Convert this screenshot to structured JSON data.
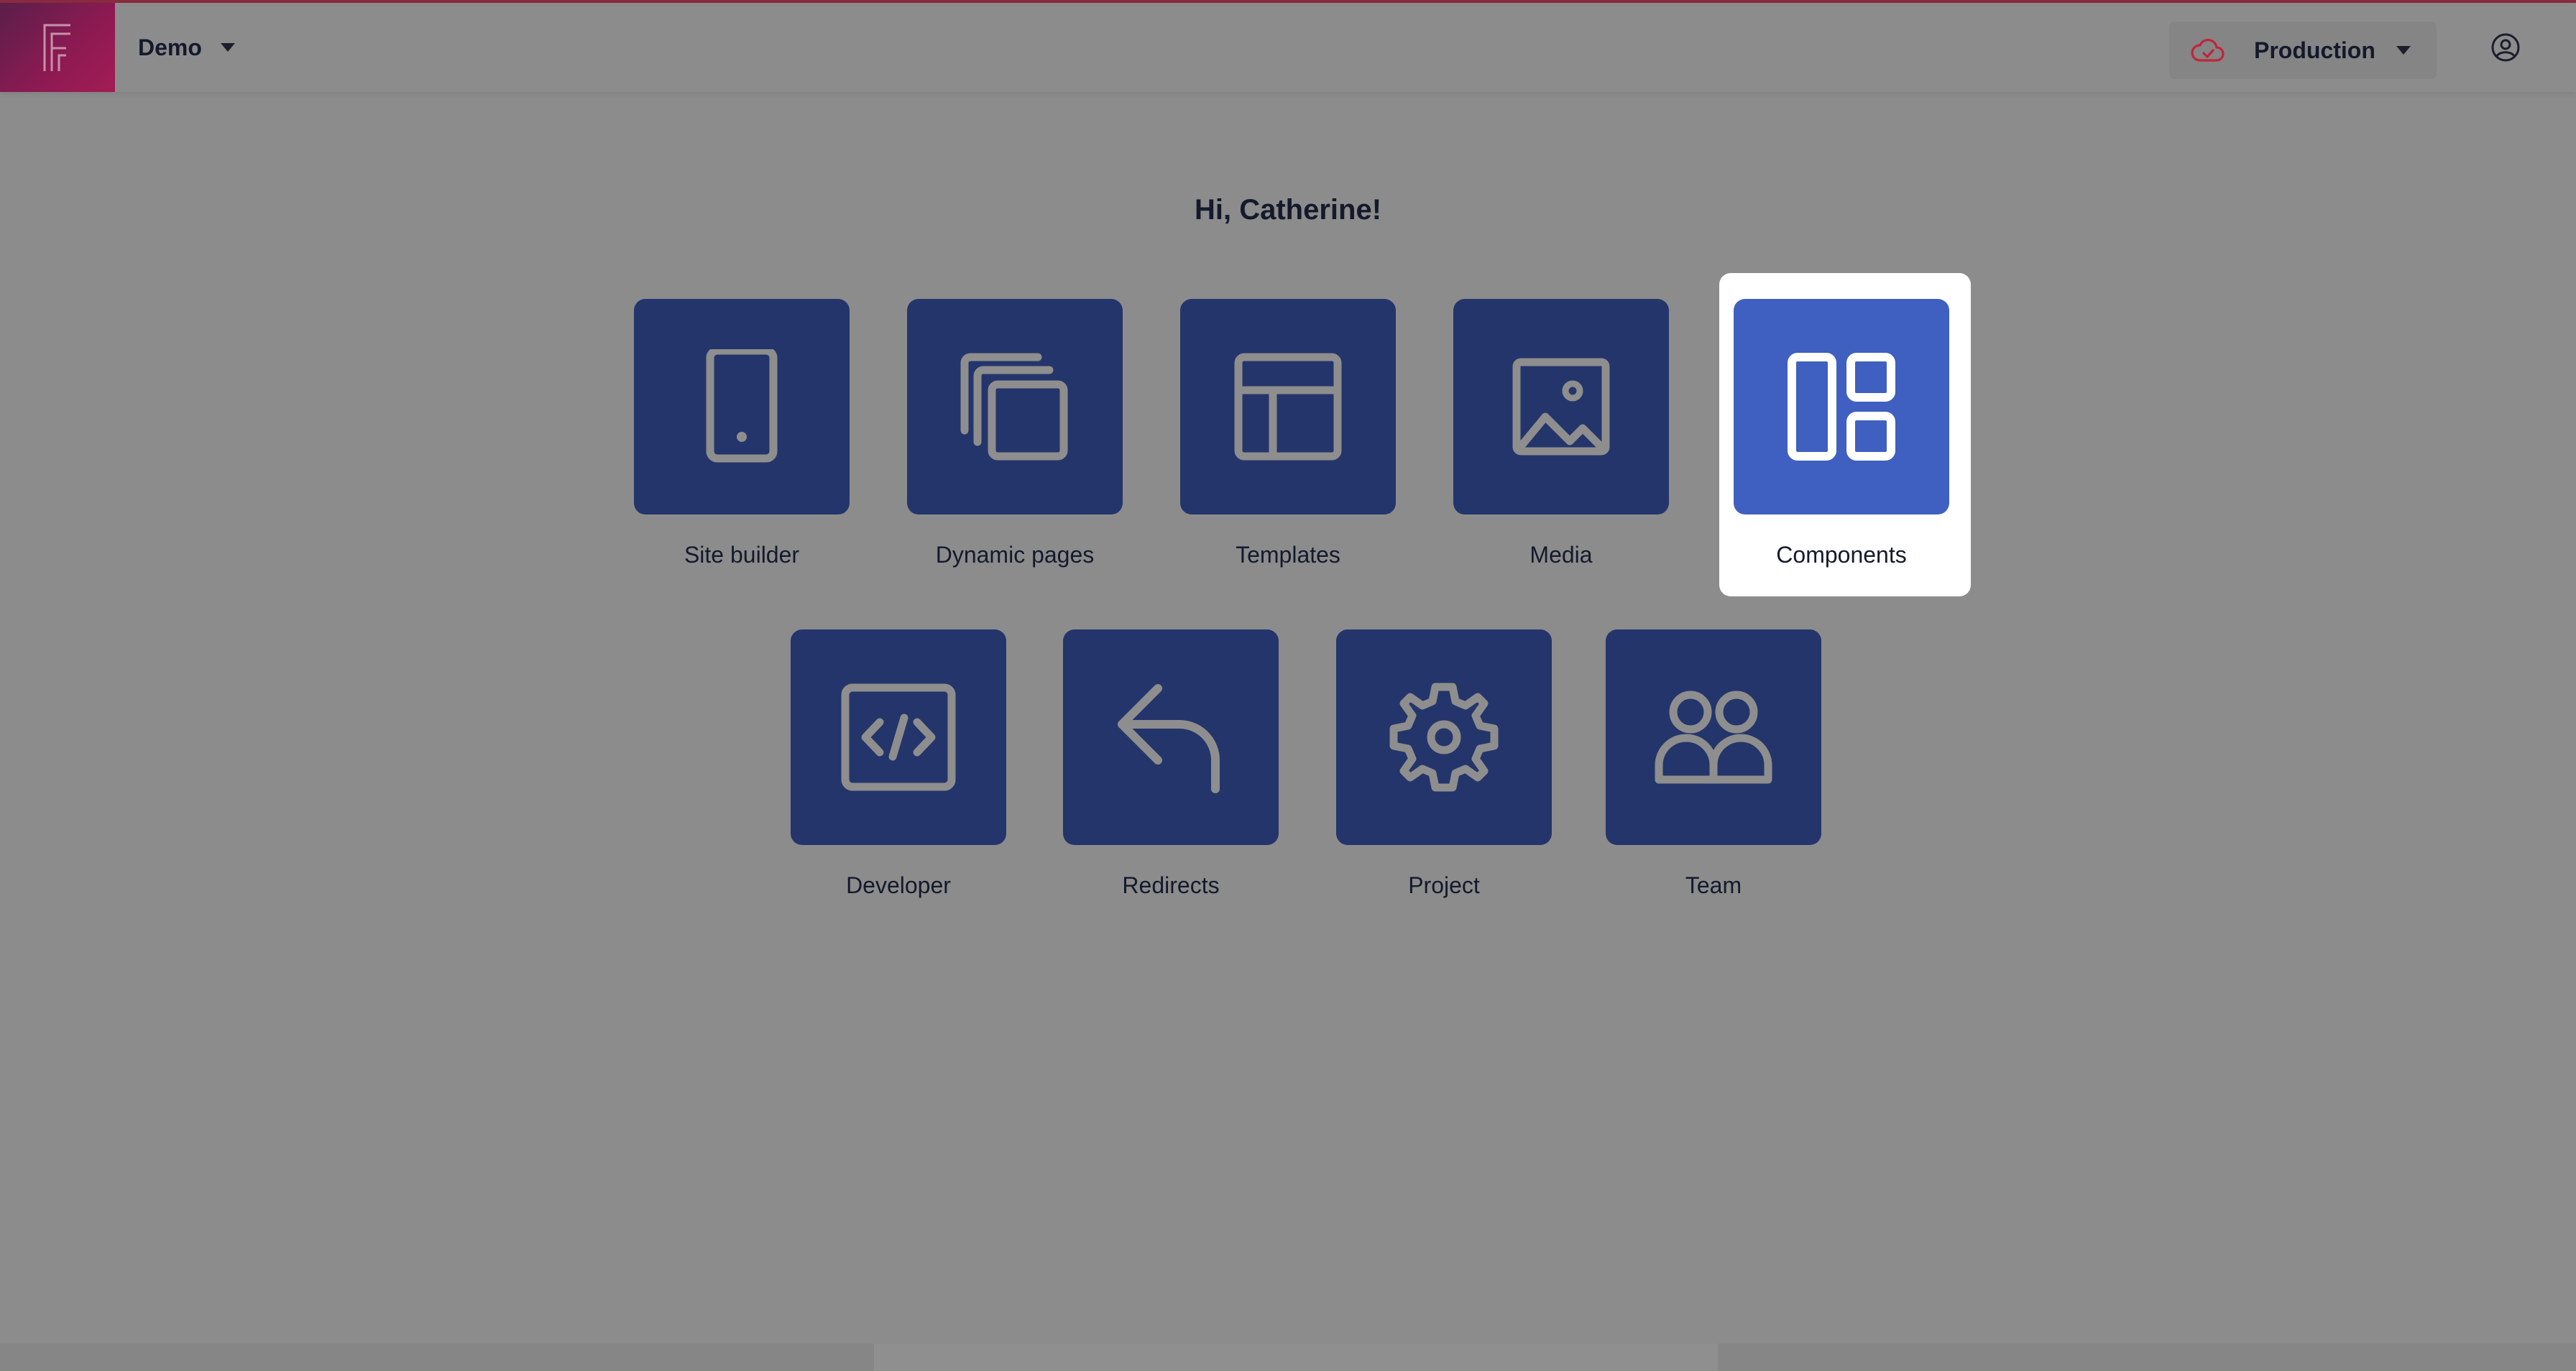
{
  "header": {
    "project_name": "Demo",
    "environment": "Production",
    "colors": {
      "logo_gradient": [
        "#5a1f4a",
        "#a31c55"
      ],
      "env_icon": "#c0253a"
    },
    "icons": {
      "logo": "f-logo-icon",
      "project_caret": "caret-down-icon",
      "environment": "cloud-check-icon",
      "env_caret": "caret-down-icon",
      "account": "user-circle-icon"
    }
  },
  "greeting": "Hi, Catherine!",
  "tiles": [
    {
      "label": "Site builder",
      "icon": "tablet-icon"
    },
    {
      "label": "Dynamic pages",
      "icon": "stacked-pages-icon"
    },
    {
      "label": "Templates",
      "icon": "layout-template-icon"
    },
    {
      "label": "Media",
      "icon": "image-icon"
    },
    {
      "label": "Components",
      "icon": "components-icon",
      "highlighted": true
    },
    {
      "label": "Developer",
      "icon": "code-icon"
    },
    {
      "label": "Redirects",
      "icon": "redirect-arrow-icon"
    },
    {
      "label": "Project",
      "icon": "gear-icon"
    },
    {
      "label": "Team",
      "icon": "users-icon"
    }
  ],
  "colors": {
    "tile_bg": "#24356b",
    "tile_active_bg": "#3f60c0",
    "icon_stroke": "#8e8e8e",
    "overlay": "#8c8c8c"
  }
}
